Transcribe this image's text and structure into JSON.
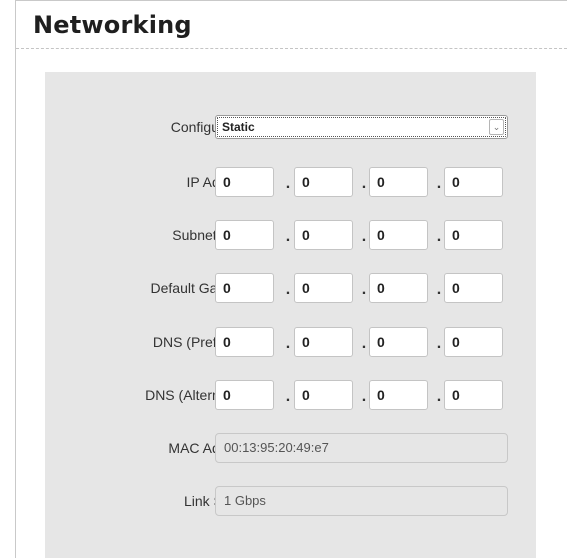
{
  "page": {
    "title": "Networking"
  },
  "form": {
    "configuration": {
      "label": "Configuration",
      "value": "Static"
    },
    "ip_address": {
      "label": "IP Address",
      "octets": [
        "0",
        "0",
        "0",
        "0"
      ]
    },
    "subnet_mask": {
      "label": "Subnet Mask",
      "octets": [
        "0",
        "0",
        "0",
        "0"
      ]
    },
    "default_gateway": {
      "label": "Default Gateway",
      "octets": [
        "0",
        "0",
        "0",
        "0"
      ]
    },
    "dns_preferred": {
      "label": "DNS (Preferred)",
      "octets": [
        "0",
        "0",
        "0",
        "0"
      ]
    },
    "dns_alternative": {
      "label": "DNS (Alternative)",
      "octets": [
        "0",
        "0",
        "0",
        "0"
      ]
    },
    "mac_address": {
      "label": "MAC Address",
      "value": "00:13:95:20:49:e7"
    },
    "link_speed": {
      "label": "Link Speed",
      "value": "1 Gbps"
    },
    "octet_separator": "."
  },
  "icons": {
    "dropdown": "chevron-down-icon"
  },
  "colors": {
    "panel_bg": "#e6e6e6",
    "field_border": "#c4c4c4"
  }
}
